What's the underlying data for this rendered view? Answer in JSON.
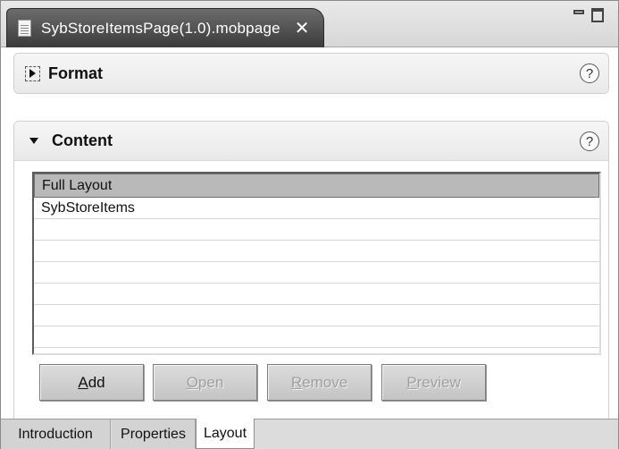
{
  "editor": {
    "tab_title": "SybStoreItemsPage(1.0).mobpage",
    "close_glyph": "✕",
    "icon": "document-icon"
  },
  "sections": {
    "format": {
      "title": "Format",
      "help": "?"
    },
    "content": {
      "title": "Content",
      "help": "?"
    }
  },
  "table": {
    "header": "Full Layout",
    "rows": [
      "SybStoreItems",
      "",
      "",
      "",
      "",
      "",
      "",
      ""
    ]
  },
  "buttons": {
    "add": {
      "label_u": "A",
      "label_rest": "dd",
      "enabled": true
    },
    "open": {
      "label_u": "O",
      "label_rest": "pen",
      "enabled": false
    },
    "remove": {
      "label_u": "R",
      "label_rest": "emove",
      "enabled": false
    },
    "preview": {
      "label_u": "P",
      "label_rest": "review",
      "enabled": false
    }
  },
  "bottom_tabs": {
    "introduction": "Introduction",
    "properties": "Properties",
    "layout": "Layout",
    "active": "Layout"
  }
}
